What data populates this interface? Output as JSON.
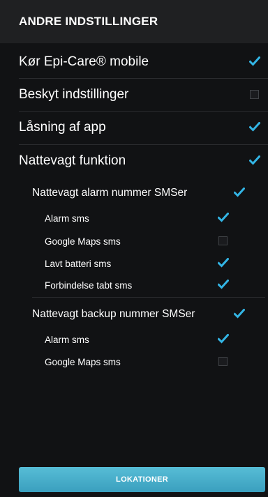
{
  "header": {
    "title": "ANDRE INDSTILLINGER"
  },
  "settings": {
    "run_mobile": {
      "label": "Kør Epi-Care® mobile",
      "checked": true
    },
    "protect_settings": {
      "label": "Beskyt indstillinger",
      "checked": false
    },
    "app_lock": {
      "label": "Låsning af app",
      "checked": true
    },
    "night_watch": {
      "label": "Nattevagt funktion",
      "checked": true
    },
    "alarm_number": {
      "label": "Nattevagt alarm nummer SMSer",
      "checked": true,
      "items": [
        {
          "label": "Alarm sms",
          "checked": true
        },
        {
          "label": "Google Maps sms",
          "checked": false
        },
        {
          "label": "Lavt batteri sms",
          "checked": true
        },
        {
          "label": "Forbindelse tabt sms",
          "checked": true
        }
      ]
    },
    "backup_number": {
      "label": "Nattevagt backup nummer SMSer",
      "checked": true,
      "items": [
        {
          "label": "Alarm sms",
          "checked": true
        },
        {
          "label": "Google Maps sms",
          "checked": false
        }
      ]
    }
  },
  "footer": {
    "button_label": "LOKATIONER"
  },
  "colors": {
    "accent": "#33b5e5",
    "button": "#48aecb",
    "header_bg": "#1f2022",
    "bg": "#111214"
  },
  "icons": {
    "checked": "checkmark-icon",
    "unchecked": "empty-checkbox"
  }
}
